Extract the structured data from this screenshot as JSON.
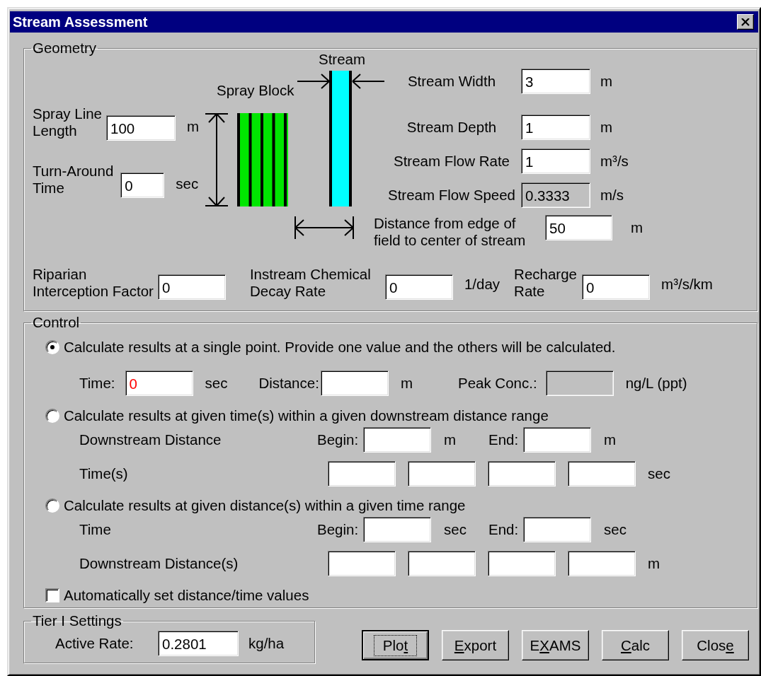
{
  "window": {
    "title": "Stream Assessment"
  },
  "geometry": {
    "legend": "Geometry",
    "diagram": {
      "stream_label": "Stream",
      "spray_block_label": "Spray Block"
    },
    "left_fields": [
      {
        "label_lines": [
          "Spray Line",
          "Length"
        ],
        "value": "100",
        "unit": "m",
        "read_only": false
      },
      {
        "label_lines": [
          "Turn-Around",
          "Time"
        ],
        "value": "0",
        "unit": "sec",
        "read_only": false
      }
    ],
    "right_fields": [
      {
        "label": "Stream Width",
        "value": "3",
        "unit": "m",
        "read_only": false
      },
      {
        "label": "Stream Depth",
        "value": "1",
        "unit": "m",
        "read_only": false
      },
      {
        "label": "Stream Flow Rate",
        "value": "1",
        "unit": "m³/s",
        "read_only": false
      },
      {
        "label": "Stream Flow Speed",
        "value": "0.3333",
        "unit": "m/s",
        "read_only": true
      }
    ],
    "distance": {
      "label_lines": [
        "Distance from edge of",
        "field to center of stream"
      ],
      "value": "50",
      "unit": "m",
      "read_only": false
    },
    "bottom_fields": [
      {
        "label_lines": [
          "Riparian",
          "Interception Factor"
        ],
        "value": "0",
        "read_only": false
      },
      {
        "label_lines": [
          "Instream Chemical",
          "Decay Rate"
        ],
        "value": "0",
        "unit": "1/day",
        "read_only": false
      },
      {
        "label_lines": [
          "Recharge",
          "Rate"
        ],
        "value": "0",
        "unit": "m³/s/km",
        "read_only": false
      }
    ]
  },
  "control": {
    "legend": "Control",
    "options": [
      {
        "kind": "point",
        "label": "Calculate results at a single point. Provide one value and the others will be calculated.",
        "selected": true,
        "fields": [
          {
            "label": "Time:",
            "value": "0",
            "error": true,
            "unit": "sec",
            "read_only": false
          },
          {
            "label": "Distance:",
            "unit": "m",
            "read_only": false
          },
          {
            "label": "Peak Conc.:",
            "unit": "ng/L (ppt)",
            "read_only": true
          }
        ]
      },
      {
        "kind": "range",
        "label": "Calculate results at given time(s) within a given downstream distance range",
        "selected": false,
        "range": {
          "label": "Downstream Distance",
          "begin_label": "Begin:",
          "begin_unit": "m",
          "end_label": "End:",
          "end_unit": "m"
        },
        "list": {
          "label": "Time(s)",
          "unit": "sec",
          "fields": [
            {
              "read_only": false
            },
            {
              "read_only": false
            },
            {
              "read_only": false
            },
            {
              "read_only": false
            }
          ]
        }
      },
      {
        "kind": "range",
        "label": "Calculate results at given distance(s) within a given time range",
        "selected": false,
        "range": {
          "label": "Time",
          "begin_label": "Begin:",
          "begin_unit": "sec",
          "end_label": "End:",
          "end_unit": "sec"
        },
        "list": {
          "label": "Downstream Distance(s)",
          "unit": "m",
          "fields": [
            {
              "read_only": false
            },
            {
              "read_only": false
            },
            {
              "read_only": false
            },
            {
              "read_only": false
            }
          ]
        }
      }
    ],
    "checkbox": {
      "label": "Automatically set distance/time values",
      "checked": false
    }
  },
  "tier": {
    "legend": "Tier I Settings",
    "label": "Active Rate:",
    "value": "0.2801",
    "unit": "kg/ha"
  },
  "buttons": [
    {
      "parts": [
        {
          "text": "Plo",
          "underlined": false
        },
        {
          "text": "t",
          "underlined": true
        }
      ],
      "focused": true
    },
    {
      "parts": [
        {
          "text": "E",
          "underlined": true
        },
        {
          "text": "xport",
          "underlined": false
        }
      ],
      "focused": false
    },
    {
      "parts": [
        {
          "text": "E",
          "underlined": false
        },
        {
          "text": "X",
          "underlined": true
        },
        {
          "text": "AMS",
          "underlined": false
        }
      ],
      "focused": false
    },
    {
      "parts": [
        {
          "text": "C",
          "underlined": true
        },
        {
          "text": "alc",
          "underlined": false
        }
      ],
      "focused": false
    },
    {
      "parts": [
        {
          "text": "Clos",
          "underlined": false
        },
        {
          "text": "e",
          "underlined": true
        }
      ],
      "focused": false
    }
  ]
}
